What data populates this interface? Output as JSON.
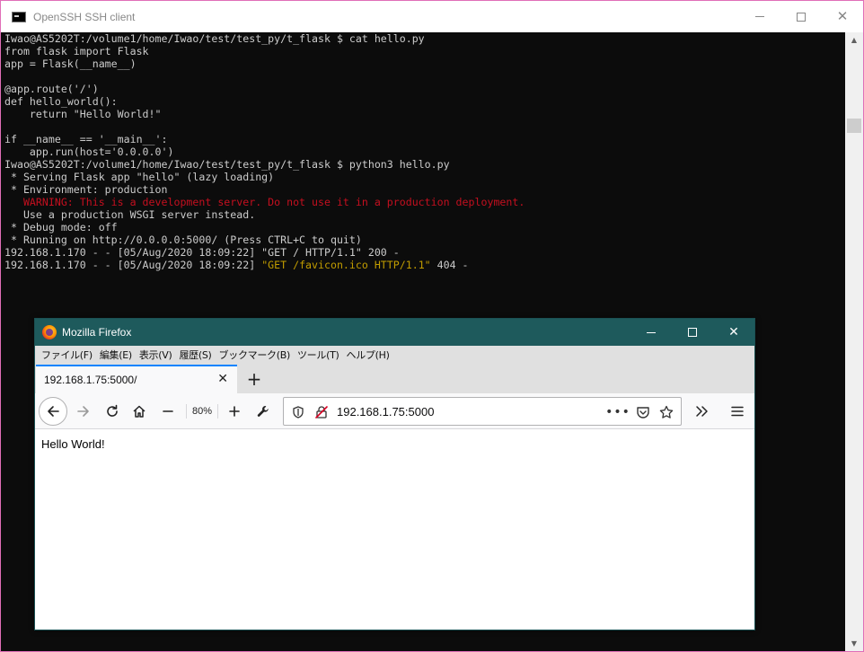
{
  "ssh_window": {
    "title": "OpenSSH SSH client",
    "terminal_lines": [
      [
        {
          "text": "Iwao@AS5202T:/volume1/home/Iwao/test/test_py/t_flask $ cat hello.py"
        }
      ],
      [
        {
          "text": "from flask import Flask"
        }
      ],
      [
        {
          "text": "app = Flask(__name__)"
        }
      ],
      [
        {
          "text": ""
        }
      ],
      [
        {
          "text": "@app.route('/')"
        }
      ],
      [
        {
          "text": "def hello_world():"
        }
      ],
      [
        {
          "text": "    return \"Hello World!\""
        }
      ],
      [
        {
          "text": ""
        }
      ],
      [
        {
          "text": "if __name__ == '__main__':"
        }
      ],
      [
        {
          "text": "    app.run(host='0.0.0.0')"
        }
      ],
      [
        {
          "text": "Iwao@AS5202T:/volume1/home/Iwao/test/test_py/t_flask $ python3 hello.py"
        }
      ],
      [
        {
          "text": " * Serving Flask app \"hello\" (lazy loading)"
        }
      ],
      [
        {
          "text": " * Environment: production"
        }
      ],
      [
        {
          "text": "   WARNING: This is a development server. Do not use it in a production deployment.",
          "color": "red"
        }
      ],
      [
        {
          "text": "   Use a production WSGI server instead."
        }
      ],
      [
        {
          "text": " * Debug mode: off"
        }
      ],
      [
        {
          "text": " * Running on http://0.0.0.0:5000/ (Press CTRL+C to quit)"
        }
      ],
      [
        {
          "text": "192.168.1.170 - - [05/Aug/2020 18:09:22] \"GET / HTTP/1.1\" 200 -"
        }
      ],
      [
        {
          "text": "192.168.1.170 - - [05/Aug/2020 18:09:22] "
        },
        {
          "text": "\"GET /favicon.ico HTTP/1.1\"",
          "color": "yellow"
        },
        {
          "text": " 404 -"
        }
      ]
    ],
    "colors": {
      "background": "#0c0c0c",
      "text": "#cccccc",
      "red": "#c50f1f",
      "yellow": "#c19c00",
      "border": "#e06fb8"
    }
  },
  "firefox": {
    "title": "Mozilla Firefox",
    "menu": [
      "ファイル(F)",
      "編集(E)",
      "表示(V)",
      "履歴(S)",
      "ブックマーク(B)",
      "ツール(T)",
      "ヘルプ(H)"
    ],
    "tab": {
      "title": "192.168.1.75:5000/",
      "close": "✕"
    },
    "new_tab": "+",
    "zoom": "80%",
    "url": "192.168.1.75:5000",
    "page_text": "Hello World!",
    "colors": {
      "titlebar": "#1e5a5c",
      "tab_accent": "#0a84ff"
    }
  },
  "icons": {
    "back": "back-arrow-icon",
    "forward": "forward-arrow-icon",
    "reload": "reload-icon",
    "home": "home-icon",
    "zoom_out": "zoom-out-icon",
    "zoom_in": "zoom-in-icon",
    "customize": "wrench-icon",
    "shield": "shield-icon",
    "insecure": "insecure-lock-icon",
    "page_actions": "more-actions-icon",
    "pocket": "pocket-icon",
    "bookmark": "star-icon",
    "overflow": "overflow-icon",
    "menu": "hamburger-icon"
  }
}
